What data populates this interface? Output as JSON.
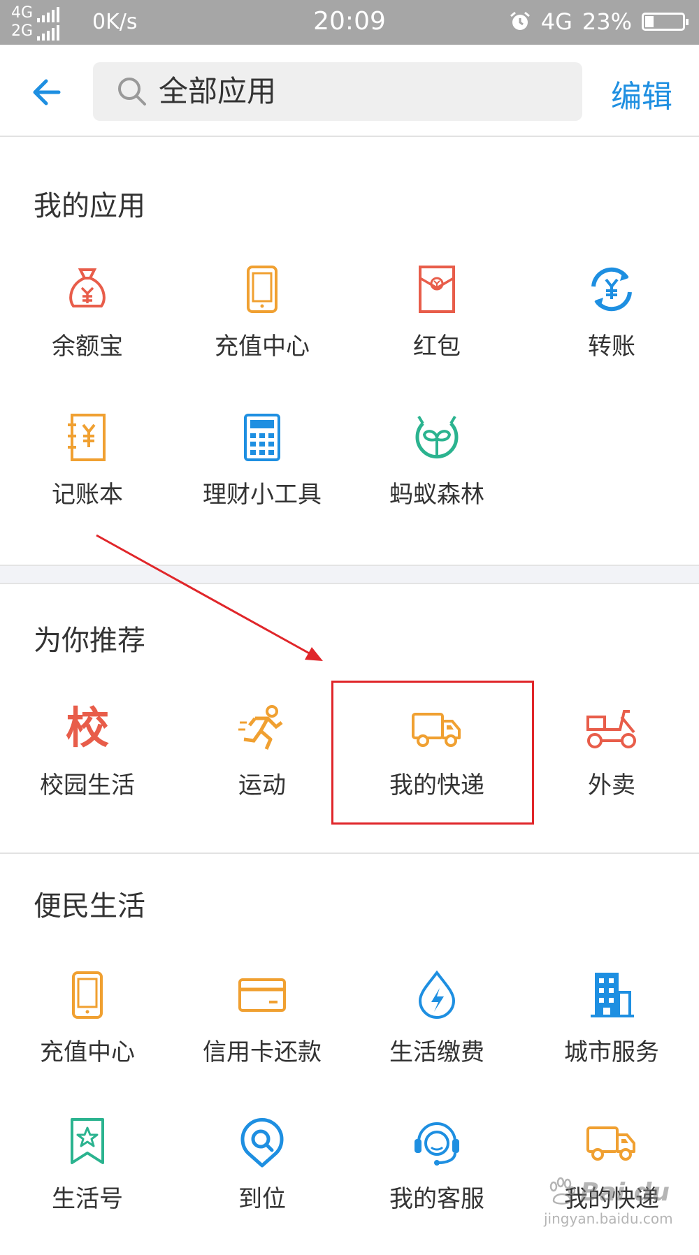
{
  "status_bar": {
    "sim1": "4G",
    "sim2": "2G",
    "speed": "0K/s",
    "time": "20:09",
    "network": "4G",
    "battery": "23%",
    "battery_level": 0.23
  },
  "header": {
    "search_placeholder": "全部应用",
    "edit_label": "编辑"
  },
  "sections": [
    {
      "title": "我的应用",
      "apps": [
        {
          "label": "余额宝",
          "icon": "money-bag-icon",
          "color": "#e85d4a"
        },
        {
          "label": "充值中心",
          "icon": "phone-icon",
          "color": "#f0a031"
        },
        {
          "label": "红包",
          "icon": "red-envelope-icon",
          "color": "#e85d4a"
        },
        {
          "label": "转账",
          "icon": "transfer-icon",
          "color": "#1e8fe1"
        },
        {
          "label": "记账本",
          "icon": "ledger-icon",
          "color": "#f0a031"
        },
        {
          "label": "理财小工具",
          "icon": "calculator-icon",
          "color": "#1e8fe1"
        },
        {
          "label": "蚂蚁森林",
          "icon": "sprout-icon",
          "color": "#2bb38f"
        }
      ]
    },
    {
      "title": "为你推荐",
      "apps": [
        {
          "label": "校园生活",
          "icon": "campus-icon",
          "glyph": "校",
          "color": "#e85d4a"
        },
        {
          "label": "运动",
          "icon": "runner-icon",
          "color": "#f0a031"
        },
        {
          "label": "我的快递",
          "icon": "truck-icon",
          "color": "#f0a031"
        },
        {
          "label": "外卖",
          "icon": "scooter-icon",
          "color": "#e85d4a"
        }
      ]
    },
    {
      "title": "便民生活",
      "apps": [
        {
          "label": "充值中心",
          "icon": "phone-icon",
          "color": "#f0a031"
        },
        {
          "label": "信用卡还款",
          "icon": "credit-card-icon",
          "color": "#f0a031"
        },
        {
          "label": "生活缴费",
          "icon": "utility-drop-icon",
          "color": "#1e8fe1"
        },
        {
          "label": "城市服务",
          "icon": "building-icon",
          "color": "#1e8fe1"
        },
        {
          "label": "生活号",
          "icon": "bookmark-star-icon",
          "color": "#2bb38f"
        },
        {
          "label": "到位",
          "icon": "location-search-icon",
          "color": "#1e8fe1"
        },
        {
          "label": "我的客服",
          "icon": "customer-service-icon",
          "color": "#1e8fe1"
        },
        {
          "label": "我的快递",
          "icon": "truck-icon",
          "color": "#f0a031"
        }
      ]
    }
  ],
  "watermark": {
    "brand": "Bai du",
    "site": "jingyan.baidu.com"
  }
}
